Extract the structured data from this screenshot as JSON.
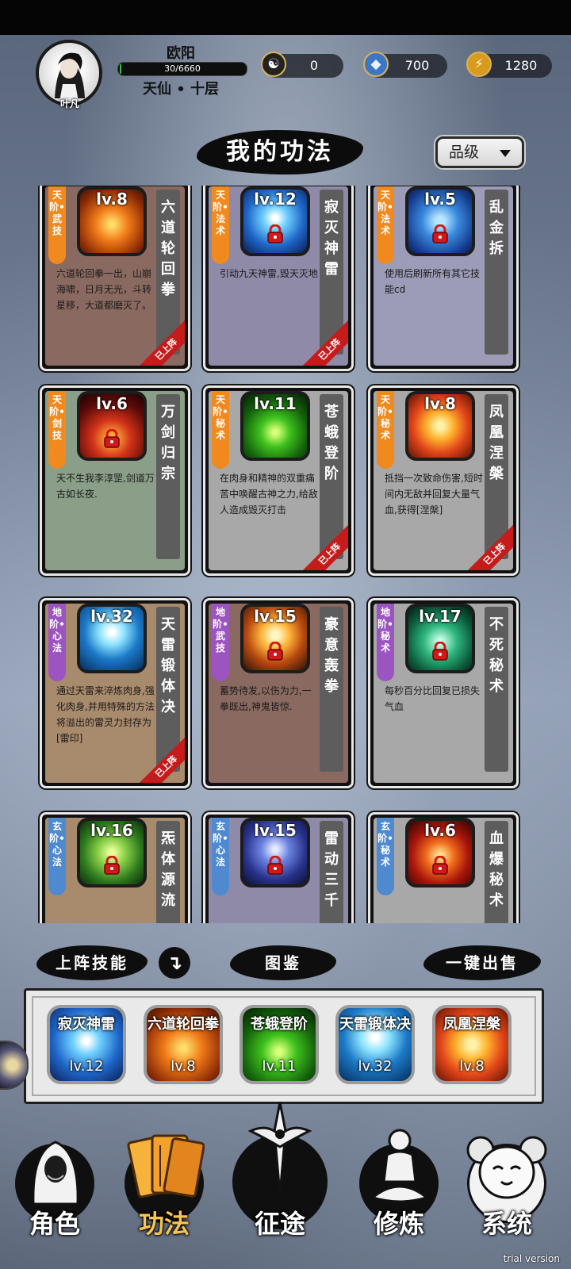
{
  "player": {
    "avatar_name": "叶凡",
    "name": "欧阳",
    "exp_text": "30/6660",
    "exp_fraction": 0.0045,
    "realm": "天仙 • 十层"
  },
  "resources": [
    {
      "icon": "yin-yang-icon",
      "value": "0"
    },
    {
      "icon": "spirit-stone-icon",
      "value": "700"
    },
    {
      "icon": "lightning-coin-icon",
      "value": "1280"
    }
  ],
  "page_title": "我的功法",
  "sort_dropdown": {
    "label": "品级"
  },
  "skills": [
    {
      "rank": "天阶•武技",
      "rank_color": "#f08a1e",
      "level": "lv.8",
      "name": "六道轮回拳",
      "desc": "六道轮回拳一出，山崩海啸，日月无光，斗转星移，大道都磨灭了。",
      "bg": "#8a6a60",
      "icon_theme": "fire",
      "locked": false,
      "equipped": "已上阵"
    },
    {
      "rank": "天阶•法术",
      "rank_color": "#f08a1e",
      "level": "lv.12",
      "name": "寂灭神雷",
      "desc": "引动九天神雷,毁天灭地",
      "bg": "#8e8aa8",
      "icon_theme": "blue",
      "locked": true,
      "equipped": "已上阵"
    },
    {
      "rank": "天阶•法术",
      "rank_color": "#f08a1e",
      "level": "lv.5",
      "name": "乱金拆",
      "desc": "使用后刷新所有其它技能cd",
      "bg": "#9c9cb8",
      "icon_theme": "hex",
      "locked": true,
      "equipped": ""
    },
    {
      "rank": "天阶•剑技",
      "rank_color": "#f08a1e",
      "level": "lv.6",
      "name": "万剑归宗",
      "desc": "天不生我李淳罡,剑道万古如长夜.",
      "bg": "#8a9e88",
      "icon_theme": "dark-fire",
      "locked": true,
      "equipped": ""
    },
    {
      "rank": "天阶•秘术",
      "rank_color": "#f08a1e",
      "level": "lv.11",
      "name": "苍蛾登阶",
      "desc": "在肉身和精神的双重痛苦中唤醒古神之力,给敌人造成毁灭打击",
      "bg": "#a8a8a8",
      "icon_theme": "green",
      "locked": false,
      "equipped": "已上阵"
    },
    {
      "rank": "天阶•秘术",
      "rank_color": "#f08a1e",
      "level": "lv.8",
      "name": "凤凰涅槃",
      "desc": "抵挡一次致命伤害,短时间内无敌并回复大量气血,获得[涅槃]",
      "bg": "#a8a8a8",
      "icon_theme": "phoenix",
      "locked": false,
      "equipped": "已上阵"
    },
    {
      "rank": "地阶•心法",
      "rank_color": "#9c54c0",
      "level": "lv.32",
      "name": "天雷锻体决",
      "desc": "通过天雷来淬炼肉身,强化肉身,并用特殊的方法将溢出的雷灵力封存为[雷印]",
      "bg": "#a88a6c",
      "icon_theme": "lightning",
      "locked": false,
      "equipped": "已上阵"
    },
    {
      "rank": "地阶•武技",
      "rank_color": "#9c54c0",
      "level": "lv.15",
      "name": "豪意轰拳",
      "desc": "蓄势待发,以伤为力,一拳既出,神鬼皆惊.",
      "bg": "#8a6a60",
      "icon_theme": "explosion",
      "locked": true,
      "equipped": ""
    },
    {
      "rank": "地阶•秘术",
      "rank_color": "#9c54c0",
      "level": "lv.17",
      "name": "不死秘术",
      "desc": "每秒百分比回复已损失气血",
      "bg": "#a8a8a8",
      "icon_theme": "teal",
      "locked": true,
      "equipped": ""
    },
    {
      "rank": "玄阶•心法",
      "rank_color": "#4f8ad0",
      "level": "lv.16",
      "name": "炁体源流",
      "desc": "",
      "bg": "#a88a6c",
      "icon_theme": "green-swirl",
      "locked": true,
      "equipped": ""
    },
    {
      "rank": "玄阶•心法",
      "rank_color": "#4f8ad0",
      "level": "lv.15",
      "name": "雷动三千",
      "desc": "",
      "bg": "#8e8aa8",
      "icon_theme": "storm",
      "locked": true,
      "equipped": ""
    },
    {
      "rank": "玄阶•秘术",
      "rank_color": "#4f8ad0",
      "level": "lv.6",
      "name": "血爆秘术",
      "desc": "",
      "bg": "#a8a8a8",
      "icon_theme": "red-demon",
      "locked": true,
      "equipped": ""
    }
  ],
  "actions": {
    "deploy_label": "上阵技能",
    "switch_icon": "↴",
    "codex_label": "图鉴",
    "sell_label": "一键出售"
  },
  "equipped_slots": [
    {
      "name": "寂灭神雷",
      "level": "lv.12",
      "icon_theme": "blue"
    },
    {
      "name": "六道轮回拳",
      "level": "lv.8",
      "icon_theme": "fire"
    },
    {
      "name": "苍蛾登阶",
      "level": "lv.11",
      "icon_theme": "green"
    },
    {
      "name": "天雷锻体决",
      "level": "lv.32",
      "icon_theme": "lightning"
    },
    {
      "name": "凤凰涅槃",
      "level": "lv.8",
      "icon_theme": "phoenix"
    }
  ],
  "nav": [
    {
      "label": "角色",
      "icon": "character-icon",
      "active": false
    },
    {
      "label": "功法",
      "icon": "scroll-book-icon",
      "active": true
    },
    {
      "label": "征途",
      "icon": "sword-emblem-icon",
      "active": false
    },
    {
      "label": "修炼",
      "icon": "meditation-icon",
      "active": false
    },
    {
      "label": "系统",
      "icon": "system-mascot-icon",
      "active": false
    }
  ],
  "watermark": "trial version"
}
